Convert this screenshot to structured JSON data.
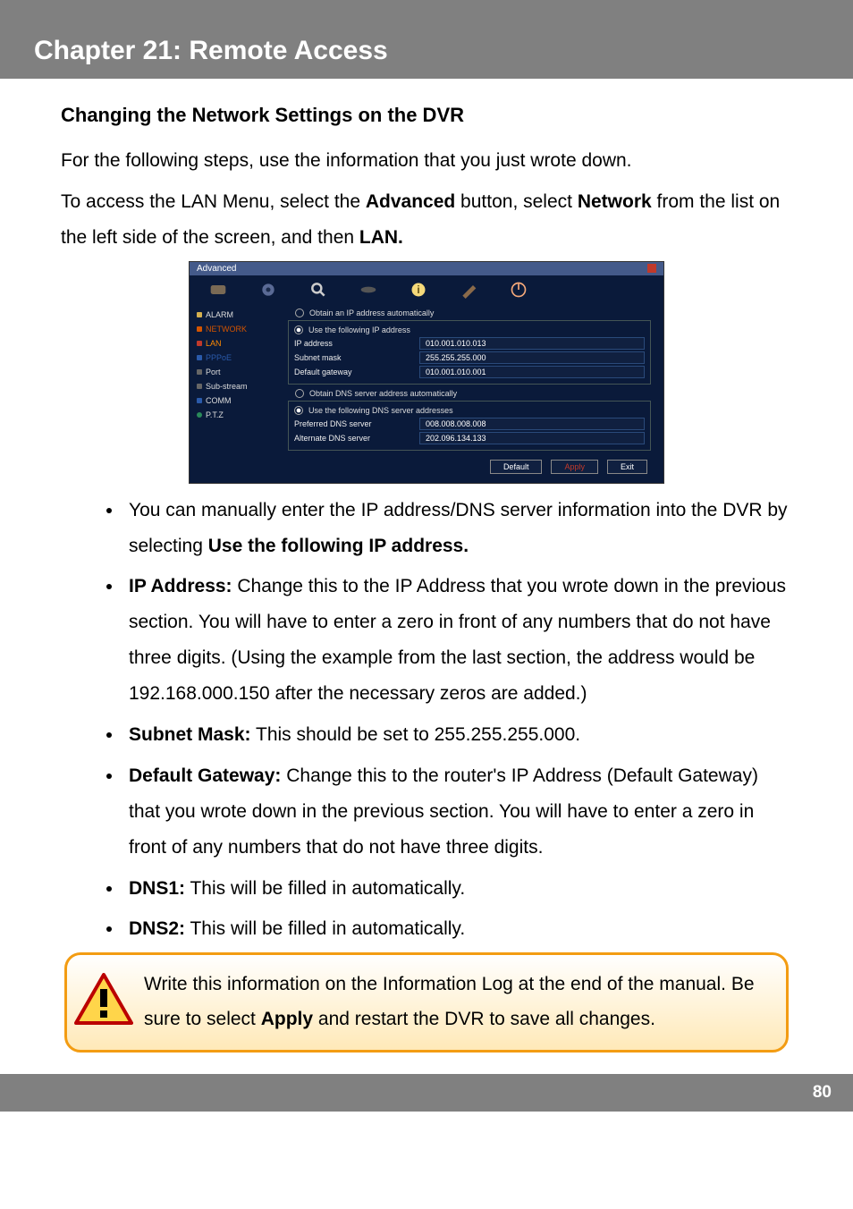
{
  "chapter_title": "Chapter 21: Remote Access",
  "section_title": "Changing the Network Settings on the DVR",
  "intro_line": "For the following steps, use the information that you just wrote down.",
  "lan_access_pre": "To access the LAN Menu, select the ",
  "lan_access_bold1": "Advanced",
  "lan_access_mid": " button, select ",
  "lan_access_bold2": "Network",
  "lan_access_post": " from the list on the left side of the screen, and then ",
  "lan_access_bold3": "LAN.",
  "screenshot": {
    "window_title": "Advanced",
    "side_items": [
      "ALARM",
      "NETWORK",
      "LAN",
      "PPPoE",
      "Port",
      "Sub-stream",
      "COMM",
      "P.T.Z"
    ],
    "radio_auto_ip": "Obtain an IP address automatically",
    "radio_static_ip": "Use the following IP address",
    "ip_label": "IP address",
    "ip_value": "010.001.010.013",
    "mask_label": "Subnet mask",
    "mask_value": "255.255.255.000",
    "gw_label": "Default gateway",
    "gw_value": "010.001.010.001",
    "radio_auto_dns": "Obtain DNS server address automatically",
    "radio_static_dns": "Use the following DNS server addresses",
    "dns1_label": "Preferred DNS server",
    "dns1_value": "008.008.008.008",
    "dns2_label": "Alternate DNS server",
    "dns2_value": "202.096.134.133",
    "btn_default": "Default",
    "btn_apply": "Apply",
    "btn_exit": "Exit"
  },
  "bullets": {
    "b1_pre": "You can manually enter the IP address/DNS server information into the DVR by selecting ",
    "b1_bold": "Use the following IP address.",
    "b2_bold": "IP Address:",
    "b2_text": " Change this to the IP Address that you wrote down in the previous section. You will have to enter a zero in front of any numbers that do not have three digits. (Using the example from the last section, the address would be 192.168.000.150 after the necessary zeros are added.)",
    "b3_bold": "Subnet Mask:",
    "b3_text": " This should be set to 255.255.255.000.",
    "b4_bold": "Default Gateway:",
    "b4_text": " Change this to the router's IP Address (Default Gateway) that you wrote down in the previous section. You will have to enter a zero in front of any numbers that do not have three digits.",
    "b5_bold": "DNS1:",
    "b5_text": " This will be filled in automatically.",
    "b6_bold": "DNS2:",
    "b6_text": " This will be filled in automatically."
  },
  "callout_pre": "Write this information on the Information Log at the end of the manual. Be sure to select ",
  "callout_bold": "Apply",
  "callout_post": " and restart the DVR to save all changes.",
  "page_number": "80"
}
